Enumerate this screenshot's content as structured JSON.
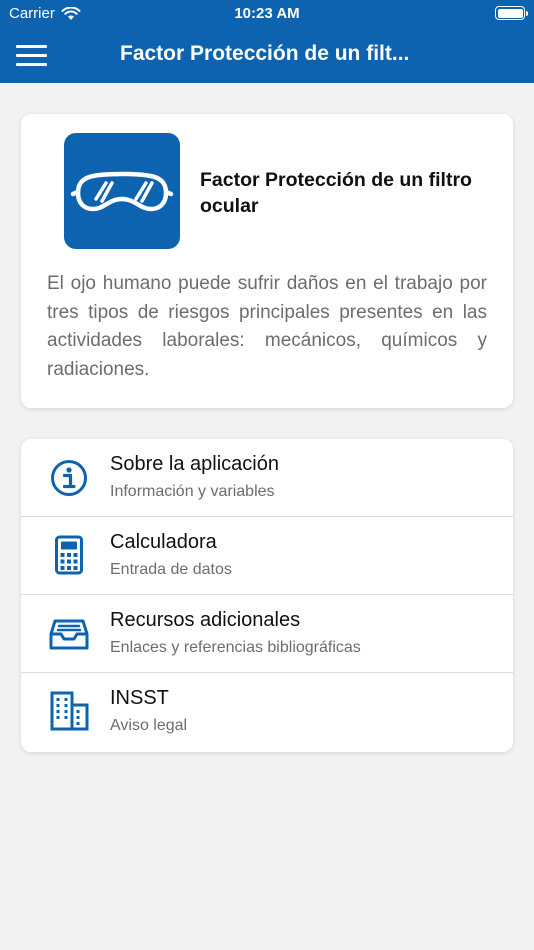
{
  "status_bar": {
    "carrier": "Carrier",
    "time": "10:23 AM",
    "icons": [
      "wifi-icon",
      "battery-icon"
    ]
  },
  "navbar": {
    "title": "Factor Protección de un filt...",
    "menu_icon": "hamburger-menu-icon",
    "background": "#0d63b0"
  },
  "header_card": {
    "icon": "safety-goggles-icon",
    "title": "Factor Protección de un filtro ocular",
    "description": "El ojo humano puede sufrir daños en el trabajo por tres tipos de riesgos principales presentes en las actividades laborales: mecánicos, químicos y radiaciones."
  },
  "menu": {
    "items": [
      {
        "icon": "info-icon",
        "title": "Sobre la aplicación",
        "subtitle": "Información y variables"
      },
      {
        "icon": "calculator-icon",
        "title": "Calculadora",
        "subtitle": "Entrada de datos"
      },
      {
        "icon": "inbox-tray-icon",
        "title": "Recursos adicionales",
        "subtitle": "Enlaces y referencias bibliográficas"
      },
      {
        "icon": "building-icon",
        "title": "INSST",
        "subtitle": "Aviso legal"
      }
    ]
  },
  "colors": {
    "accent": "#0d63b0",
    "background": "#f2f2f2",
    "card": "#ffffff",
    "secondary_text": "#6d6d6d"
  }
}
